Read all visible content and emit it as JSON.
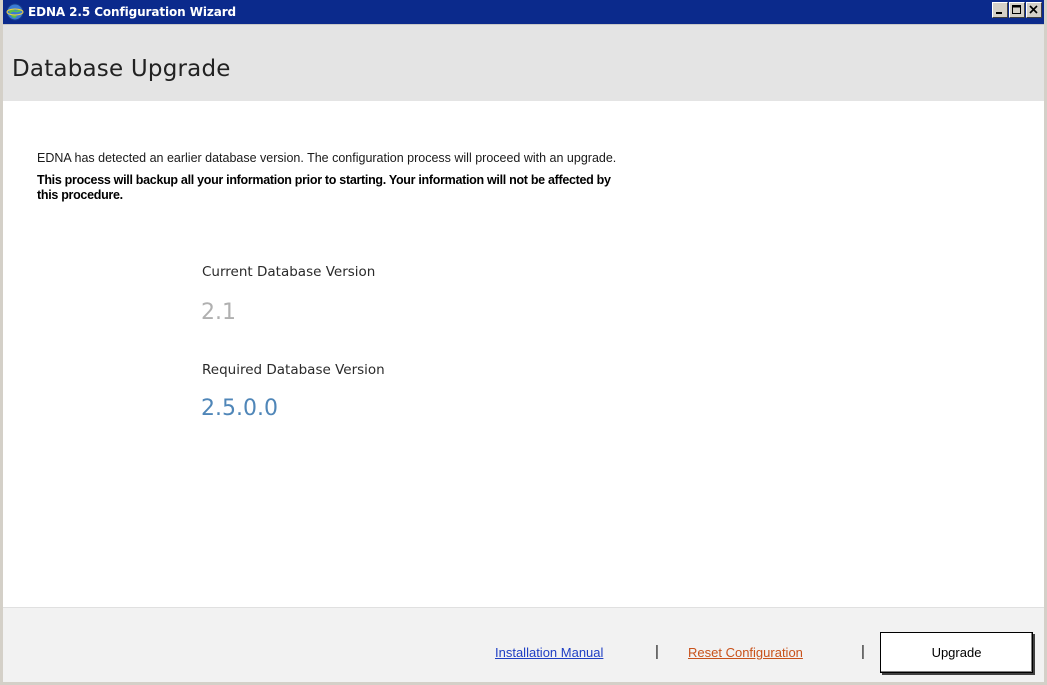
{
  "window": {
    "title": "EDNA 2.5 Configuration Wizard",
    "controls": [
      "minimize-icon",
      "maximize-icon",
      "close-icon"
    ]
  },
  "header": {
    "title": "Database Upgrade"
  },
  "content": {
    "intro": "EDNA has detected an earlier database version. The configuration process will proceed with an upgrade.",
    "warning": "This process will backup all your information prior to starting. Your information will not be affected by this procedure.",
    "current_label": "Current Database Version",
    "current_value": "2.1",
    "required_label": "Required Database Version",
    "required_value": "2.5.0.0"
  },
  "footer": {
    "manual_link": "Installation Manual",
    "separator": "|",
    "reset_link": "Reset Configuration",
    "upgrade_button": "Upgrade"
  },
  "colors": {
    "titlebar": "#0b2a8c",
    "header_bg": "#e4e4e4",
    "current_value": "#b0b0b0",
    "required_value": "#4f86b8",
    "manual_link": "#1f3fc4",
    "reset_link": "#c8521b"
  }
}
